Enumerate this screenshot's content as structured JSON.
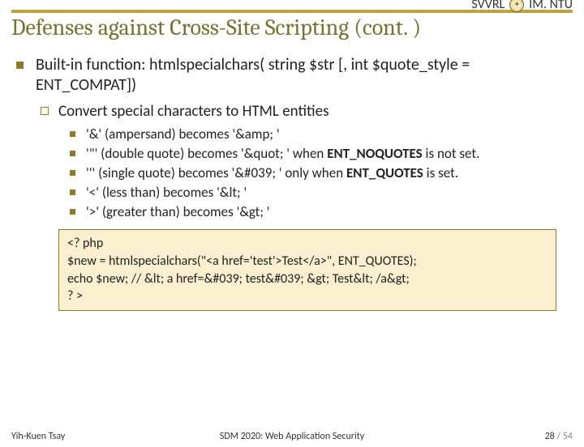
{
  "header": {
    "left_org": "SVVRL",
    "right_org": "IM. NTU",
    "logo_hint": "ntu-seal"
  },
  "title": "Defenses against Cross-Site Scripting (cont. )",
  "bullet_main": "Built-in function: htmlspecialchars( string $str [, int $quote_style = ENT_COMPAT])",
  "sub_bullet": "Convert special characters to HTML entities",
  "items": [
    {
      "text": "'&' (ampersand) becomes '&amp; '"
    },
    {
      "prefix": "'\"' (double quote) becomes '&quot; ' when ",
      "bold": "ENT_NOQUOTES",
      "suffix": " is not set."
    },
    {
      "prefix": "''' (single quote) becomes '&#039; ' only when ",
      "bold": "ENT_QUOTES",
      "suffix": " is set."
    },
    {
      "text": "'<' (less than) becomes '&lt; '"
    },
    {
      "text": "'>' (greater than) becomes '&gt; '"
    }
  ],
  "code": {
    "l1": "<? php",
    "l2": "$new = htmlspecialchars(\"<a href='test'>Test</a>\", ENT_QUOTES);",
    "l3": "echo $new; // &lt; a href=&#039; test&#039; &gt; Test&lt; /a&gt;",
    "l4": "? >"
  },
  "footer": {
    "author": "Yih-Kuen Tsay",
    "course": "SDM 2020: Web Application Security",
    "page": "28",
    "sep": " / ",
    "total": "54"
  }
}
